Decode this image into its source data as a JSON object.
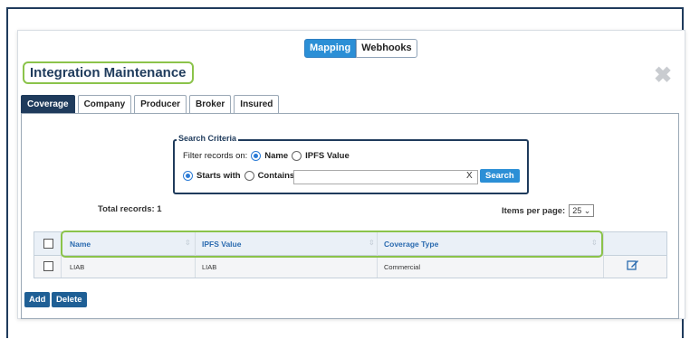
{
  "top_toggle": {
    "mapping": "Mapping",
    "webhooks": "Webhooks"
  },
  "dialog": {
    "title": "Integration Maintenance",
    "close_icon": "close-icon"
  },
  "tabs": [
    {
      "label": "Coverage",
      "active": true
    },
    {
      "label": "Company",
      "active": false
    },
    {
      "label": "Producer",
      "active": false
    },
    {
      "label": "Broker",
      "active": false
    },
    {
      "label": "Insured",
      "active": false
    }
  ],
  "search": {
    "legend": "Search Criteria",
    "filter_label": "Filter records on:",
    "filter_options": [
      "Name",
      "IPFS Value"
    ],
    "filter_selected": "Name",
    "match_options": [
      "Starts with",
      "Contains"
    ],
    "match_selected": "Starts with",
    "input_value": "",
    "clear_label": "X",
    "button_label": "Search"
  },
  "summary": {
    "total_label": "Total records: 1",
    "items_per_page_label": "Items per page:",
    "items_per_page_value": "25"
  },
  "grid": {
    "columns": [
      "Name",
      "IPFS Value",
      "Coverage Type"
    ],
    "rows": [
      {
        "name": "LIAB",
        "ipfs_value": "LIAB",
        "coverage_type": "Commercial",
        "action_icon": "edit-icon"
      }
    ]
  },
  "actions": {
    "add": "Add",
    "delete": "Delete"
  },
  "colors": {
    "navy": "#1f3b5c",
    "accent_blue": "#2b8fd6",
    "highlight_green": "#8bc34a"
  }
}
